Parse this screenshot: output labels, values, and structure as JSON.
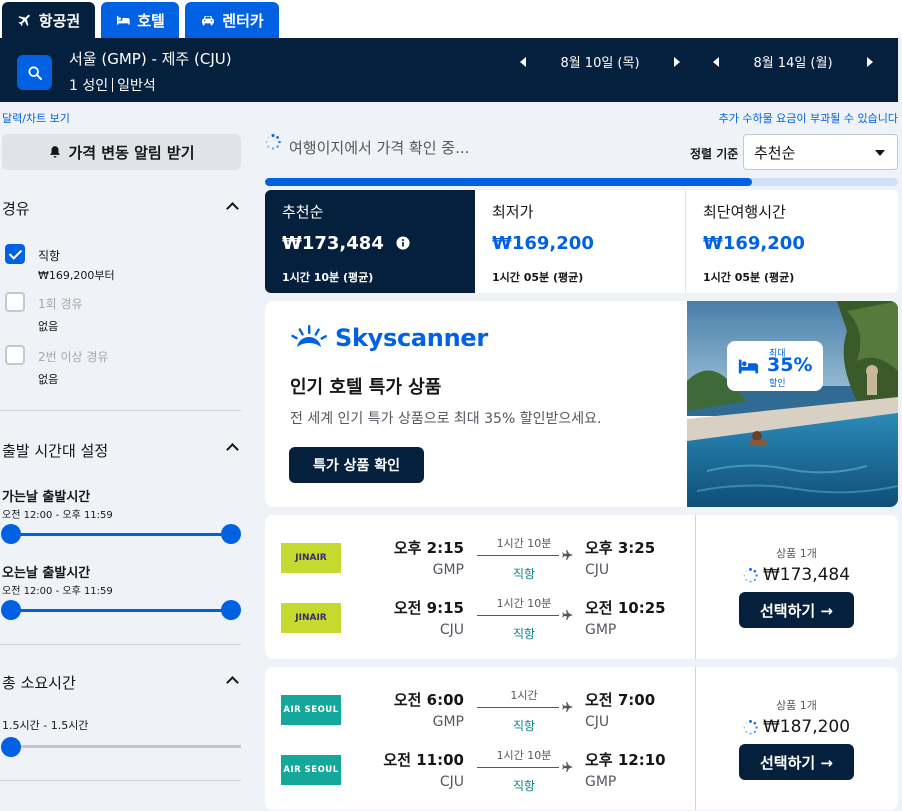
{
  "tabs": [
    {
      "label": "항공권",
      "icon": "airplane-icon",
      "active": true
    },
    {
      "label": "호텔",
      "icon": "bed-icon",
      "active": false
    },
    {
      "label": "렌터카",
      "icon": "car-icon",
      "active": false
    }
  ],
  "search": {
    "route": "서울 (GMP) - 제주 (CJU)",
    "passengers": "1 성인",
    "cabin": "일반석",
    "depart_date": "8월 10일 (목)",
    "return_date": "8월 14일 (월)"
  },
  "sidebar": {
    "calendar_link": "달력/차트 보기",
    "price_alert": "가격 변동 알림 받기",
    "stops": {
      "title": "경유",
      "options": [
        {
          "label": "직항",
          "sub": "₩169,200부터",
          "checked": true
        },
        {
          "label": "1회 경유",
          "sub": "없음",
          "checked": false
        },
        {
          "label": "2번 이상 경유",
          "sub": "없음",
          "checked": false
        }
      ]
    },
    "times": {
      "title": "출발 시간대 설정",
      "outbound_label": "가는날 출발시간",
      "outbound_range": "오전 12:00 - 오후 11:59",
      "return_label": "오는날 출발시간",
      "return_range": "오전 12:00 - 오후 11:59"
    },
    "duration": {
      "title": "총 소요시간",
      "range": "1.5시간 - 1.5시간"
    }
  },
  "main": {
    "fee_notice": "추가 수하물 요금이 부과될 수 있습니다",
    "status": "여행이지에서 가격 확인 중...",
    "sort_label": "정렬 기준",
    "sort_value": "추천순",
    "progress": 0.77,
    "sort_tabs": [
      {
        "label": "추천순",
        "price": "₩173,484",
        "time": "1시간 10분 (평균)",
        "active": true
      },
      {
        "label": "최저가",
        "price": "₩169,200",
        "time": "1시간 05분 (평균)",
        "active": false
      },
      {
        "label": "최단여행시간",
        "price": "₩169,200",
        "time": "1시간 05분 (평균)",
        "active": false
      }
    ]
  },
  "ad": {
    "brand": "Skyscanner",
    "title": "인기 호텔 특가 상품",
    "desc": "전 세계 인기 특가 상품으로 최대 35% 할인받으세요.",
    "button": "특가 상품 확인",
    "badge_top": "최대",
    "badge_pct": "35%",
    "badge_bottom": "할인"
  },
  "flights": [
    {
      "airline": "JINAIR",
      "legs": [
        {
          "dep_time": "오후 2:15",
          "dep_ap": "GMP",
          "duration": "1시간 10분",
          "stops": "직항",
          "arr_time": "오후 3:25",
          "arr_ap": "CJU"
        },
        {
          "dep_time": "오전 9:15",
          "dep_ap": "CJU",
          "duration": "1시간 10분",
          "stops": "직항",
          "arr_time": "오전 10:25",
          "arr_ap": "GMP"
        }
      ],
      "deals": "상품 1개",
      "price": "₩173,484",
      "select": "선택하기 →"
    },
    {
      "airline": "AIR SEOUL",
      "legs": [
        {
          "dep_time": "오전 6:00",
          "dep_ap": "GMP",
          "duration": "1시간",
          "stops": "직항",
          "arr_time": "오전 7:00",
          "arr_ap": "CJU"
        },
        {
          "dep_time": "오전 11:00",
          "dep_ap": "CJU",
          "duration": "1시간 10분",
          "stops": "직항",
          "arr_time": "오후 12:10",
          "arr_ap": "GMP"
        }
      ],
      "deals": "상품 1개",
      "price": "₩187,200",
      "select": "선택하기 →"
    }
  ],
  "colors": {
    "navy": "#05203c",
    "blue": "#0062e3",
    "teal": "#0c838a",
    "page": "#eff3f8"
  }
}
